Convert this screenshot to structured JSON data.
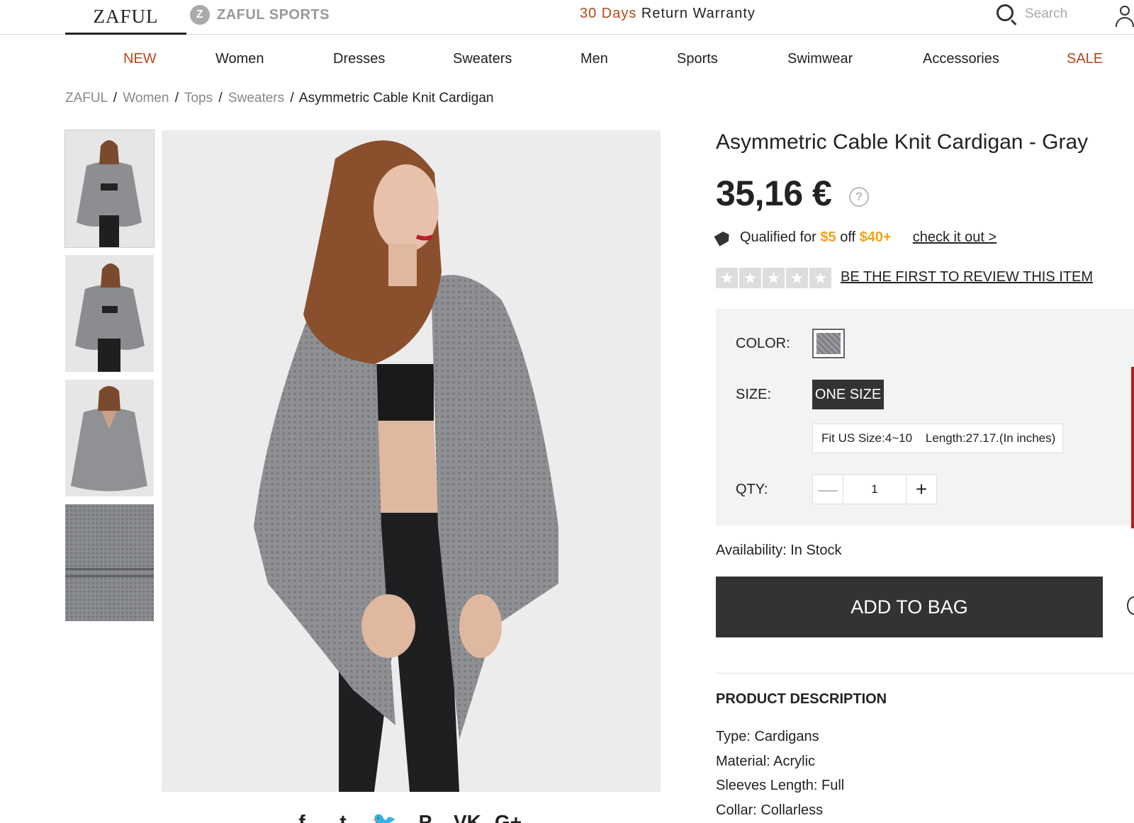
{
  "header": {
    "logo": "ZAFUL",
    "sports_icon_letter": "Z",
    "sports_label": "ZAFUL SPORTS",
    "warranty_accent": "30 Days",
    "warranty_rest": " Return Warranty",
    "search_placeholder": "Search"
  },
  "nav": {
    "items": [
      {
        "label": "NEW"
      },
      {
        "label": "Women"
      },
      {
        "label": "Dresses"
      },
      {
        "label": "Sweaters"
      },
      {
        "label": "Men"
      },
      {
        "label": "Sports"
      },
      {
        "label": "Swimwear"
      },
      {
        "label": "Accessories"
      },
      {
        "label": "SALE"
      }
    ]
  },
  "breadcrumb": {
    "items": [
      "ZAFUL",
      "Women",
      "Tops",
      "Sweaters"
    ],
    "separator": "/",
    "current": "Asymmetric Cable Knit Cardigan"
  },
  "product": {
    "title": "Asymmetric Cable Knit Cardigan - Gray",
    "price": "35,16 €",
    "price_help": "?",
    "promo": {
      "prefix": "Qualified for ",
      "discount": "$5",
      "middle": " off ",
      "threshold": "$40+",
      "link": "check it out >"
    },
    "rating_stars": 5,
    "star_glyph": "★",
    "review_link": "BE THE FIRST TO REVIEW THIS ITEM",
    "options": {
      "color_label": "COLOR:",
      "size_label": "SIZE:",
      "size_value": "ONE SIZE",
      "fit_text": "Fit US Size:4~10    Length:27.17.(In inches)",
      "qty_label": "QTY:",
      "qty_value": "1",
      "qty_minus": "—",
      "qty_plus": "+"
    },
    "availability": "Availability: In Stock",
    "add_to_bag": "ADD TO BAG",
    "description_title": "PRODUCT DESCRIPTION",
    "description": [
      "Type: Cardigans",
      "Material: Acrylic",
      "Sleeves Length: Full",
      "Collar: Collarless"
    ]
  },
  "share_icons": [
    {
      "name": "facebook-icon",
      "glyph": "f"
    },
    {
      "name": "tumblr-icon",
      "glyph": "t"
    },
    {
      "name": "twitter-icon",
      "glyph": "🐦"
    },
    {
      "name": "pinterest-icon",
      "glyph": "P"
    },
    {
      "name": "vk-icon",
      "glyph": "VK"
    },
    {
      "name": "google-plus-icon",
      "glyph": "G+"
    }
  ],
  "colors": {
    "accent": "#b7471a",
    "promo_orange": "#f5a31a",
    "button_dark": "#333333",
    "sweater_gray": "#8c8e92"
  }
}
